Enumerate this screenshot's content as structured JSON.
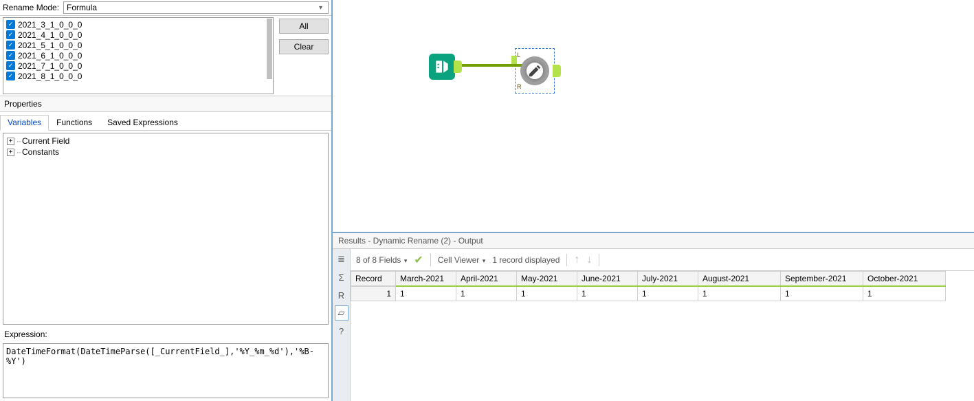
{
  "left": {
    "rename_mode_label": "Rename Mode:",
    "rename_mode_value": "Formula",
    "fields": [
      "2021_3_1_0_0_0",
      "2021_4_1_0_0_0",
      "2021_5_1_0_0_0",
      "2021_6_1_0_0_0",
      "2021_7_1_0_0_0",
      "2021_8_1_0_0_0"
    ],
    "all_btn": "All",
    "clear_btn": "Clear",
    "properties_label": "Properties",
    "tabs": {
      "variables": "Variables",
      "functions": "Functions",
      "saved": "Saved Expressions"
    },
    "tree": {
      "current_field": "Current Field",
      "constants": "Constants"
    },
    "expression_label": "Expression:",
    "expression_value": "DateTimeFormat(DateTimeParse([_CurrentField_],'%Y_%m_%d'),'%B-%Y')"
  },
  "canvas": {
    "tool1_name": "input-data-tool",
    "tool2_name": "dynamic-rename-tool",
    "port_l": "L",
    "port_r": "R"
  },
  "results": {
    "title": "Results - Dynamic Rename (2) - Output",
    "fields_summary": "8 of 8 Fields",
    "cell_viewer": "Cell Viewer",
    "records_summary": "1 record displayed",
    "row_header": "Record",
    "columns": [
      "March-2021",
      "April-2021",
      "May-2021",
      "June-2021",
      "July-2021",
      "August-2021",
      "September-2021",
      "October-2021"
    ],
    "rows": [
      {
        "num": "1",
        "cells": [
          "1",
          "1",
          "1",
          "1",
          "1",
          "1",
          "1",
          "1"
        ]
      }
    ]
  }
}
